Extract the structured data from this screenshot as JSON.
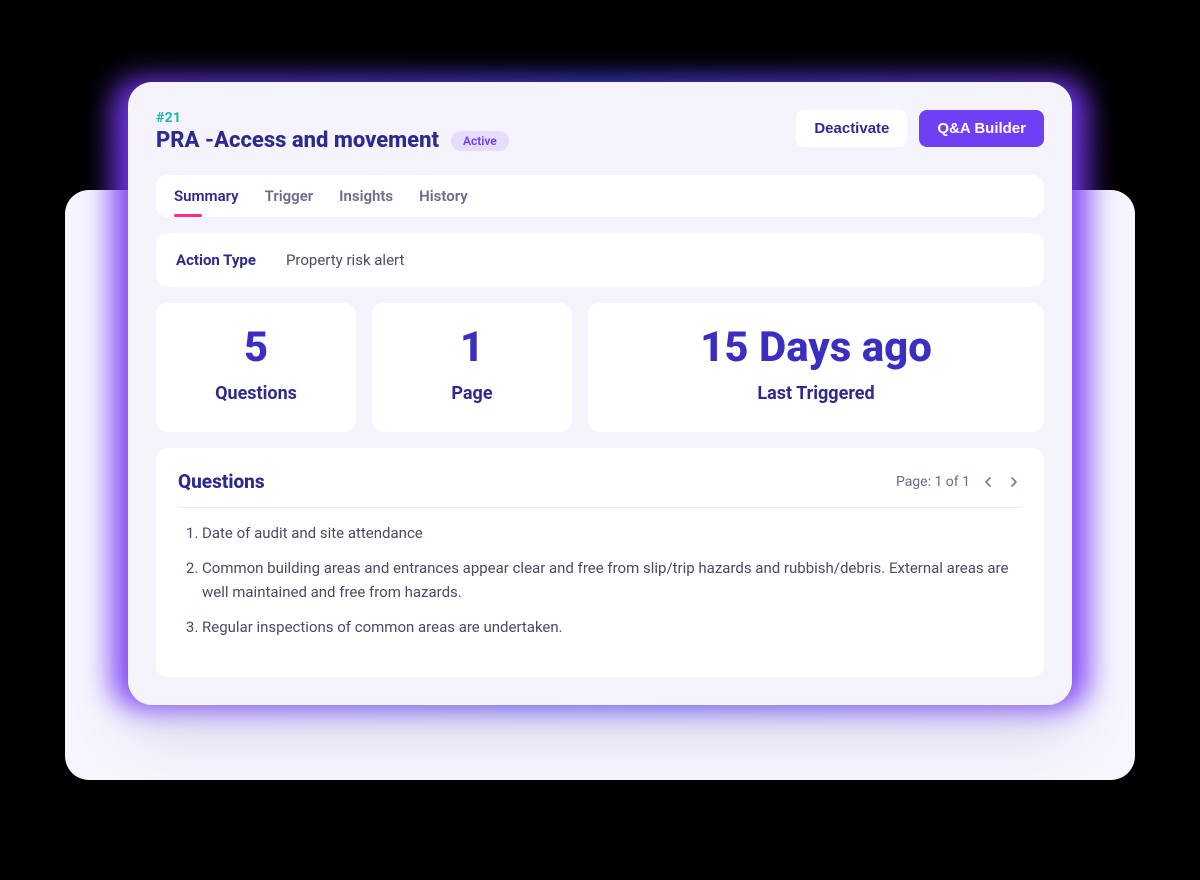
{
  "header": {
    "hash": "#21",
    "title": "PRA -Access and movement",
    "status": "Active",
    "deactivate_label": "Deactivate",
    "builder_label": "Q&A Builder"
  },
  "tabs": [
    "Summary",
    "Trigger",
    "Insights",
    "History"
  ],
  "active_tab_index": 0,
  "action_type": {
    "label": "Action Type",
    "value": "Property risk alert"
  },
  "stats": [
    {
      "value": "5",
      "label": "Questions"
    },
    {
      "value": "1",
      "label": "Page"
    },
    {
      "value": "15 Days ago",
      "label": "Last Triggered"
    }
  ],
  "questions": {
    "title": "Questions",
    "page_text": "Page: 1 of 1",
    "items": [
      "Date of audit and site attendance",
      "Common building areas and entrances appear clear and free from slip/trip hazards and rubbish/debris. External areas are well maintained and free from hazards.",
      "Regular inspections of common areas are undertaken."
    ]
  }
}
